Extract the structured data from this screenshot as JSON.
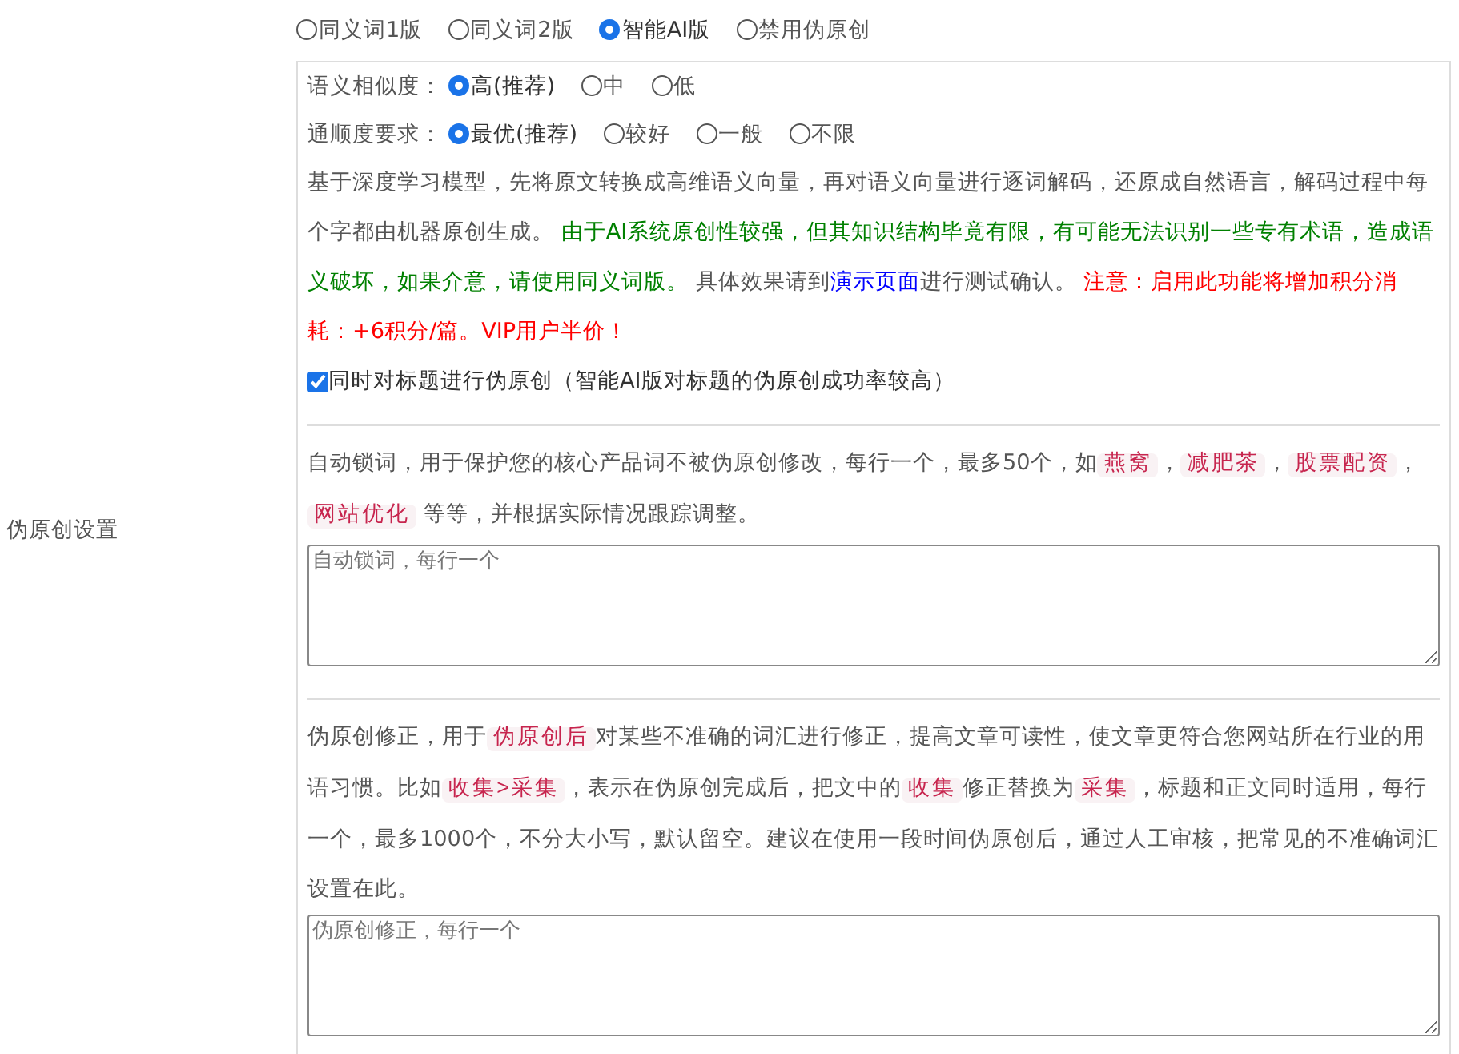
{
  "sidebar_label": "伪原创设置",
  "modes": [
    {
      "label": "同义词1版",
      "selected": false
    },
    {
      "label": "同义词2版",
      "selected": false
    },
    {
      "label": "智能AI版",
      "selected": true
    },
    {
      "label": "禁用伪原创",
      "selected": false
    }
  ],
  "similarity": {
    "label": "语义相似度：",
    "options": [
      {
        "label": "高(推荐)",
        "selected": true
      },
      {
        "label": "中",
        "selected": false
      },
      {
        "label": "低",
        "selected": false
      }
    ]
  },
  "fluency": {
    "label": "通顺度要求：",
    "options": [
      {
        "label": "最优(推荐)",
        "selected": true
      },
      {
        "label": "较好",
        "selected": false
      },
      {
        "label": "一般",
        "selected": false
      },
      {
        "label": "不限",
        "selected": false
      }
    ]
  },
  "description": [
    {
      "kind": "text",
      "text": "基于深度学习模型，先将原文转换成高维语义向量，再对语义向量进行逐词解码，还原成自然语言，解码过程中每个字都由机器原创生成。 "
    },
    {
      "kind": "green",
      "text": "由于AI系统原创性较强，但其知识结构毕竟有限，有可能无法识别一些专有术语，造成语义破坏，如果介意，请使用同义词版。"
    },
    {
      "kind": "text",
      "text": " 具体效果请到"
    },
    {
      "kind": "link",
      "text": "演示页面"
    },
    {
      "kind": "text",
      "text": "进行测试确认。 "
    },
    {
      "kind": "red",
      "text": "注意：启用此功能将增加积分消耗：+6积分/篇。VIP用户半价！"
    }
  ],
  "title_option": {
    "label": "同时对标题进行伪原创（智能AI版对标题的伪原创成功率较高）",
    "checked": true
  },
  "lock_words": {
    "description": [
      {
        "kind": "text",
        "text": "自动锁词，用于保护您的核心产品词不被伪原创修改，每行一个，最多50个，如"
      },
      {
        "kind": "code",
        "text": "燕窝"
      },
      {
        "kind": "text",
        "text": "，"
      },
      {
        "kind": "code",
        "text": "减肥茶"
      },
      {
        "kind": "text",
        "text": "，"
      },
      {
        "kind": "code",
        "text": "股票配资"
      },
      {
        "kind": "text",
        "text": "，"
      },
      {
        "kind": "code",
        "text": "网站优化"
      },
      {
        "kind": "text",
        "text": " 等等，并根据实际情况跟踪调整。"
      }
    ],
    "placeholder": "自动锁词，每行一个"
  },
  "corrections": {
    "description": [
      {
        "kind": "text",
        "text": "伪原创修正，用于"
      },
      {
        "kind": "code",
        "text": "伪原创后"
      },
      {
        "kind": "text",
        "text": "对某些不准确的词汇进行修正，提高文章可读性，使文章更符合您网站所在行业的用语习惯。比如"
      },
      {
        "kind": "code",
        "text": "收集>采集"
      },
      {
        "kind": "text",
        "text": "，表示在伪原创完成后，把文中的"
      },
      {
        "kind": "code",
        "text": "收集"
      },
      {
        "kind": "text",
        "text": "修正替换为"
      },
      {
        "kind": "code",
        "text": "采集"
      },
      {
        "kind": "text",
        "text": "，标题和正文同时适用，每行一个，最多1000个，不分大小写，默认留空。建议在使用一段时间伪原创后，通过人工审核，把常见的不准确词汇设置在此。"
      }
    ],
    "placeholder": "伪原创修正，每行一个"
  }
}
